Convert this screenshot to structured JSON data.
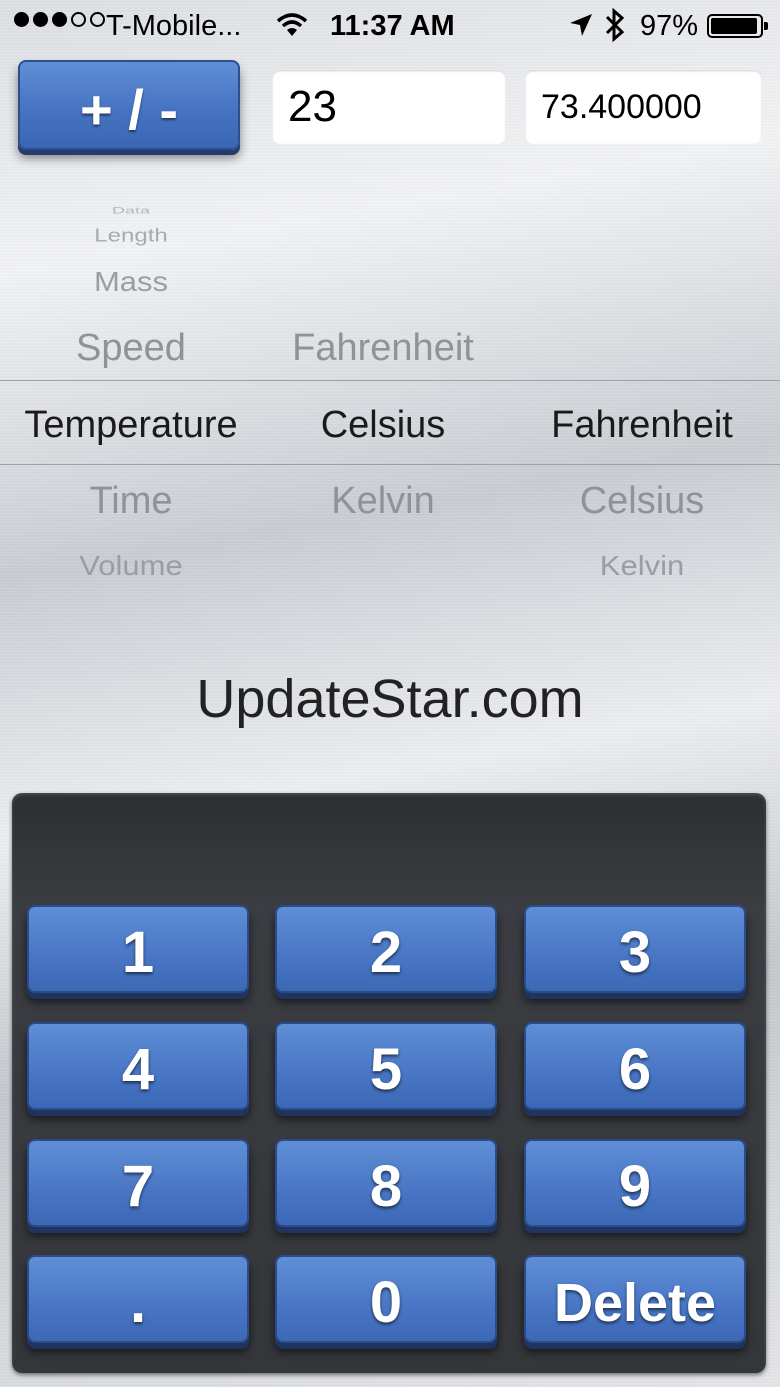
{
  "status_bar": {
    "carrier": "T-Mobile...",
    "time": "11:37 AM",
    "battery_percent": "97%",
    "signal_bars_filled": 3,
    "signal_bars_total": 5,
    "icons": [
      "wifi-icon",
      "location-arrow-icon",
      "bluetooth-icon",
      "battery-icon"
    ]
  },
  "controls": {
    "sign_button_label": "+ / -",
    "input_value": "23",
    "output_value": "73.400000"
  },
  "picker": {
    "category": {
      "above_far": "Data",
      "above_2": "Length",
      "above_1": "Mass",
      "above": "Speed",
      "selected": "Temperature",
      "below": "Time",
      "below_2": "Volume"
    },
    "from_unit": {
      "above": "Fahrenheit",
      "selected": "Celsius",
      "below": "Kelvin"
    },
    "to_unit": {
      "selected": "Fahrenheit",
      "below": "Celsius",
      "below_2": "Kelvin"
    }
  },
  "watermark": "UpdateStar.com",
  "keypad": {
    "keys": [
      "1",
      "2",
      "3",
      "4",
      "5",
      "6",
      "7",
      "8",
      "9",
      ".",
      "0",
      "Delete"
    ]
  },
  "colors": {
    "key_blue": "#4a78c6",
    "keypad_bg": "#34363a"
  }
}
